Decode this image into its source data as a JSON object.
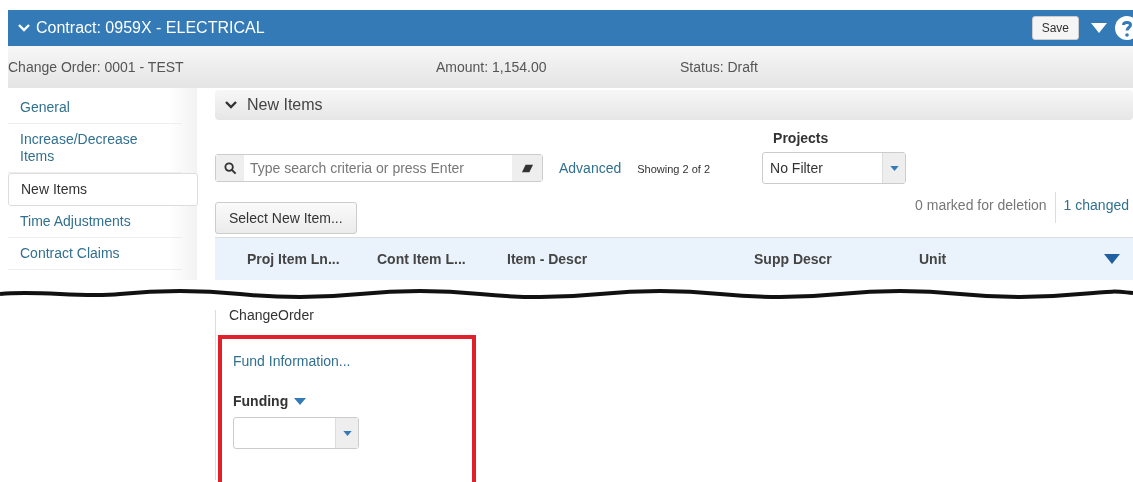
{
  "header": {
    "title": "Contract: 0959X - ELECTRICAL",
    "save": "Save"
  },
  "summary": {
    "change_order": "Change Order: 0001 - TEST",
    "amount": "Amount: 1,154.00",
    "status": "Status: Draft"
  },
  "sidebar": {
    "items": [
      {
        "label": "General",
        "selected": false
      },
      {
        "label": "Increase/Decrease Items",
        "selected": false
      },
      {
        "label": "New Items",
        "selected": true
      },
      {
        "label": "Time Adjustments",
        "selected": false
      },
      {
        "label": "Contract Claims",
        "selected": false
      }
    ]
  },
  "section": {
    "title": "New Items",
    "expanded": true
  },
  "search": {
    "placeholder": "Type search criteria or press Enter",
    "advanced": "Advanced",
    "showing": "Showing 2 of 2"
  },
  "projects": {
    "label": "Projects",
    "value": "No Filter"
  },
  "select_button": "Select New Item...",
  "counts": {
    "marked": "0 marked for deletion",
    "changed": "1 changed"
  },
  "table": {
    "columns": [
      "Proj Item Ln...",
      "Cont Item L...",
      "Item - Descr",
      "Supp Descr",
      "Unit"
    ]
  },
  "lower": {
    "caption": "ChangeOrder",
    "fund_link": "Fund Information...",
    "funding_label": "Funding",
    "highlighted": true
  }
}
